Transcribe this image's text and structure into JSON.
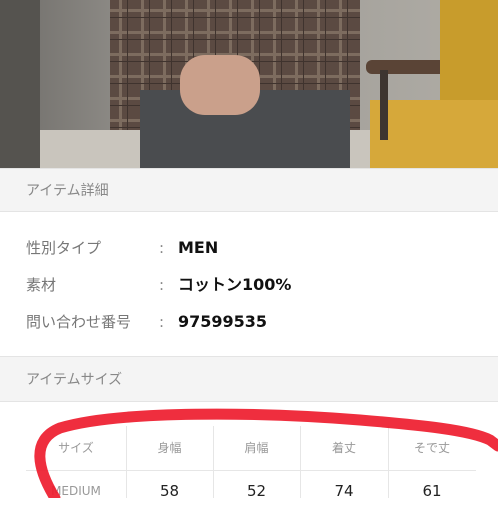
{
  "item_details": {
    "header": "アイテム詳細",
    "rows": [
      {
        "label": "性別タイプ",
        "colon": ":",
        "value": "MEN"
      },
      {
        "label": "素材",
        "colon": ":",
        "value": "コットン100%"
      },
      {
        "label": "問い合わせ番号",
        "colon": ":",
        "value": "97599535"
      }
    ]
  },
  "item_size": {
    "header": "アイテムサイズ",
    "columns": [
      "サイズ",
      "身幅",
      "肩幅",
      "着丈",
      "そで丈"
    ],
    "rows": [
      [
        "MEDIUM",
        "58",
        "52",
        "74",
        "61"
      ]
    ]
  },
  "colors": {
    "header_bg": "#f4f4f4",
    "annotation": "#ee1c2e"
  }
}
